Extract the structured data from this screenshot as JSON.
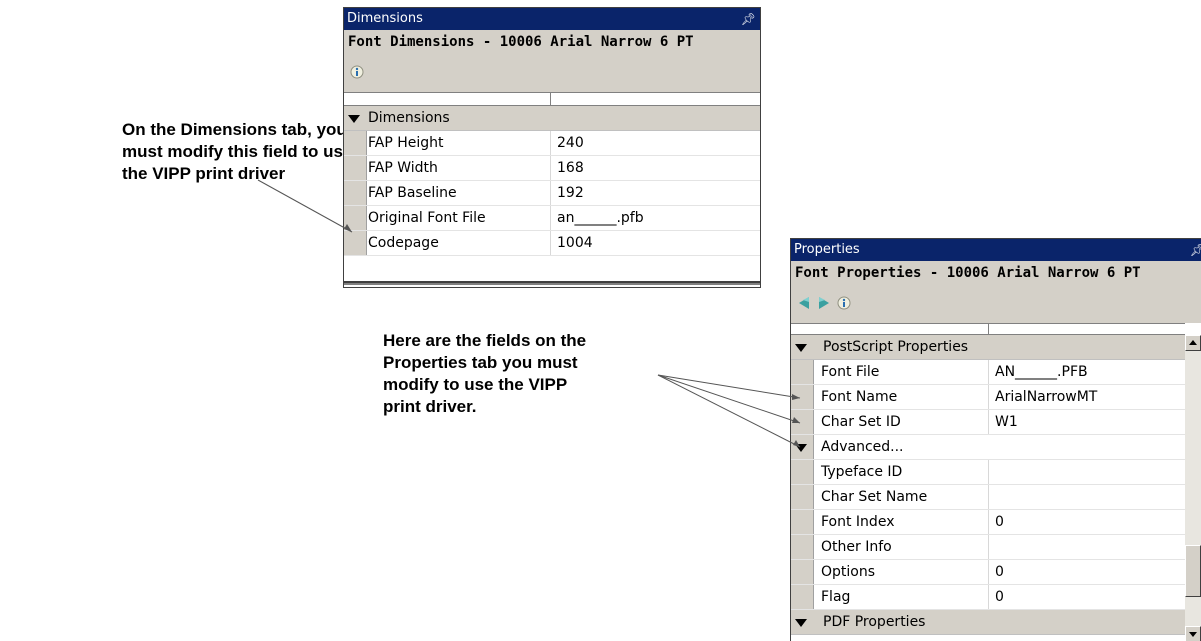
{
  "callouts": {
    "dimensions": "On the Dimensions tab, you\nmust modify this field to use\nthe VIPP print driver",
    "properties": "Here are the fields on the\nProperties tab you must\nmodify to use the VIPP\nprint driver."
  },
  "dimensions_panel": {
    "title": "Dimensions",
    "subtitle": "Font Dimensions - 10006  Arial Narrow 6 PT",
    "group": "Dimensions",
    "rows": [
      {
        "name": "FAP Height",
        "value": "240"
      },
      {
        "name": "FAP Width",
        "value": "168"
      },
      {
        "name": "FAP Baseline",
        "value": "192"
      },
      {
        "name": "Original Font File",
        "value": "an______.pfb"
      },
      {
        "name": "Codepage",
        "value": "1004"
      }
    ]
  },
  "properties_panel": {
    "title": "Properties",
    "subtitle": "Font Properties - 10006  Arial Narrow 6 PT",
    "groups": [
      {
        "label": "PostScript Properties",
        "rows": [
          {
            "name": "Font File",
            "value": "AN______.PFB"
          },
          {
            "name": "Font Name",
            "value": "ArialNarrowMT"
          },
          {
            "name": "Char Set ID",
            "value": "W1"
          }
        ]
      },
      {
        "label": "Advanced...",
        "rows": [
          {
            "name": "Typeface ID",
            "value": ""
          },
          {
            "name": "Char Set Name",
            "value": ""
          },
          {
            "name": "Font Index",
            "value": "0"
          },
          {
            "name": "Other Info",
            "value": ""
          },
          {
            "name": "Options",
            "value": "0"
          },
          {
            "name": "Flag",
            "value": "0"
          }
        ]
      },
      {
        "label": "PDF Properties",
        "rows": []
      }
    ]
  },
  "icons": {
    "info": "info-icon",
    "back": "back-arrow-icon",
    "forward": "forward-arrow-icon",
    "pin": "pin-icon",
    "collapse": "collapse-triangle-icon"
  },
  "colors": {
    "titlebar": "#0a246a",
    "panel_bg": "#d4d0c8",
    "arrow_green": "#3aa0a0"
  }
}
